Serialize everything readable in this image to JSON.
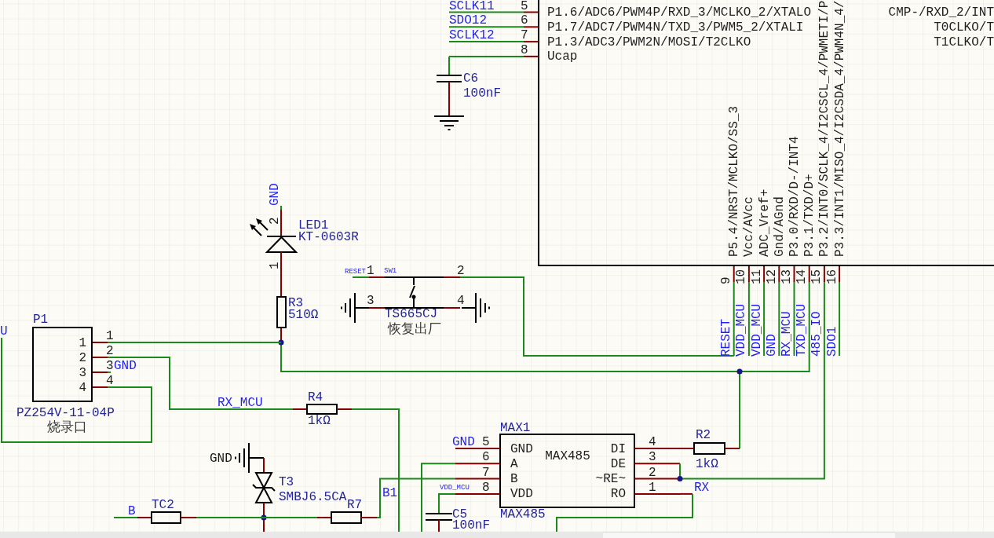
{
  "mcu": {
    "left_pins": [
      {
        "number": "5",
        "net": "SCLK11",
        "function": "P1.6/ADC6/PWM4P/RXD_3/MCLKO_2/XTALO"
      },
      {
        "number": "6",
        "net": "SDO12",
        "function": "P1.7/ADC7/PWM4N/TXD_3/PWM5_2/XTALI"
      },
      {
        "number": "7",
        "net": "SCLK12",
        "function": "P1.3/ADC3/PWM2N/MOSI/T2CLKO"
      },
      {
        "number": "8",
        "function": "Ucap"
      }
    ],
    "right_functions": [
      "CMP-/RXD_2/INT",
      "T0CLKO/T",
      "T1CLKO/T"
    ],
    "bottom_pins": [
      {
        "number": "9",
        "function": "P5.4/NRST/MCLKO/SS_3",
        "net": "RESET"
      },
      {
        "number": "10",
        "function": "Vcc/AVcc",
        "net": "VDD_MCU"
      },
      {
        "number": "11",
        "function": "ADC_Vref+",
        "net": "VDD_MCU"
      },
      {
        "number": "12",
        "function": "Gnd/AGnd",
        "net": "GND"
      },
      {
        "number": "13",
        "function": "P3.0/RXD/D-/INT4",
        "net": "RX_MCU"
      },
      {
        "number": "14",
        "function": "P3.1/TXD/D+",
        "net": "TXD_MCU"
      },
      {
        "number": "15",
        "function": "P3.2/INT0/SCLK_4/I2CSCL_4/PWMETI/P",
        "net": "485_IO"
      },
      {
        "number": "16",
        "function": "P3.3/INT1/MISO_4/I2CSDA_4/PWM4N_4/",
        "net": "SDO1"
      }
    ]
  },
  "c6": {
    "designator": "C6",
    "value": "100nF"
  },
  "led1": {
    "net": "GND",
    "pin_numbers": [
      "2",
      "1"
    ],
    "designator": "LED1",
    "part": "KT-0603R"
  },
  "r3": {
    "designator": "R3",
    "value": "510Ω"
  },
  "sw1": {
    "net": "RESET",
    "pin_numbers": [
      "1",
      "2",
      "3",
      "4"
    ],
    "designator": "SW1",
    "part": "TS665CJ",
    "comment": "恢复出厂"
  },
  "p1": {
    "edge_net": "U",
    "designator": "P1",
    "pins": [
      {
        "inner": "1",
        "outer": "1"
      },
      {
        "inner": "2",
        "outer": "2"
      },
      {
        "inner": "3",
        "outer": "3"
      },
      {
        "inner": "4",
        "outer": "4"
      }
    ],
    "net": "GND",
    "part": "PZ254V-11-04P",
    "comment": "烧录口"
  },
  "r4": {
    "net": "RX_MCU",
    "designator": "R4",
    "value": "1kΩ"
  },
  "max1": {
    "designator": "MAX1",
    "net_labels": {
      "gnd": "GND",
      "vdd": "VDD_MCU"
    },
    "left_pins": [
      {
        "number": "5",
        "name": "GND"
      },
      {
        "number": "6",
        "name": "A"
      },
      {
        "number": "7",
        "name": "B"
      },
      {
        "number": "8",
        "name": "VDD"
      }
    ],
    "body_text": "MAX485",
    "right_pins": [
      {
        "number": "4",
        "name": "DI"
      },
      {
        "number": "3",
        "name": "DE"
      },
      {
        "number": "2",
        "name": "~RE~"
      },
      {
        "number": "1",
        "name": "RO"
      }
    ],
    "comment": "MAX485"
  },
  "r2": {
    "designator": "R2",
    "value": "1kΩ"
  },
  "rx_net": "RX",
  "t3": {
    "ground": "GND",
    "designator": "T3",
    "part": "SMBJ6.5CA"
  },
  "r7": {
    "designator": "R7"
  },
  "b1_net": "B1",
  "c5": {
    "designator": "C5",
    "value": "100nF"
  },
  "tc2": {
    "net": "B",
    "designator": "TC2"
  }
}
